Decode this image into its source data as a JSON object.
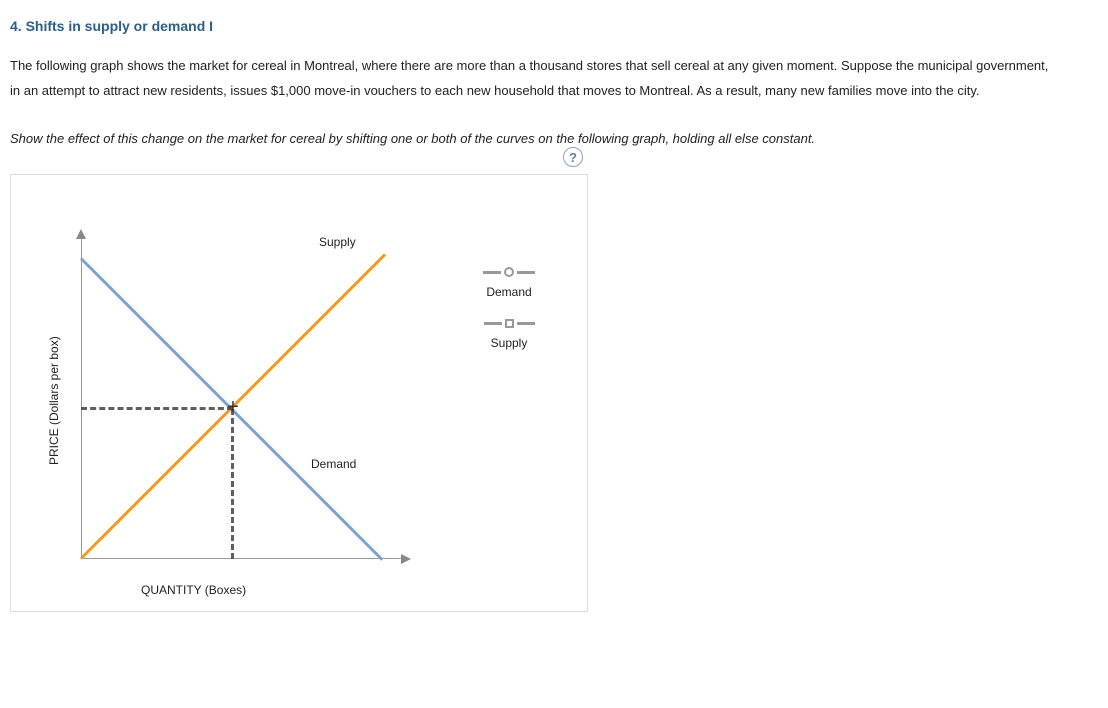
{
  "heading": "4. Shifts in supply or demand I",
  "paragraph": "The following graph shows the market for cereal in Montreal, where there are more than a thousand stores that sell cereal at any given moment. Suppose the municipal government, in an attempt to attract new residents, issues $1,000 move-in vouchers to each new household that moves to Montreal. As a result, many new families move into the city.",
  "instruction": "Show the effect of this change on the market for cereal by shifting one or both of the curves on the following graph, holding all else constant.",
  "help": "?",
  "xlabel": "QUANTITY (Boxes)",
  "ylabel": "PRICE (Dollars per box)",
  "curves": {
    "supply_label": "Supply",
    "demand_label": "Demand"
  },
  "legend": {
    "demand": "Demand",
    "supply": "Supply"
  },
  "chart_data": {
    "type": "line",
    "title": "",
    "xlabel": "QUANTITY (Boxes)",
    "ylabel": "PRICE (Dollars per box)",
    "xlim": [
      0,
      10
    ],
    "ylim": [
      0,
      10
    ],
    "series": [
      {
        "name": "Supply",
        "x": [
          0,
          10
        ],
        "y": [
          0,
          10
        ],
        "color": "#f39a1f"
      },
      {
        "name": "Demand",
        "x": [
          0,
          10
        ],
        "y": [
          10,
          0
        ],
        "color": "#7ba3cc"
      }
    ],
    "equilibrium": {
      "x": 5,
      "y": 5
    },
    "annotations": [
      {
        "text": "Supply",
        "x": 7.7,
        "y": 8.3
      },
      {
        "text": "Demand",
        "x": 7.3,
        "y": 3.2
      }
    ]
  }
}
